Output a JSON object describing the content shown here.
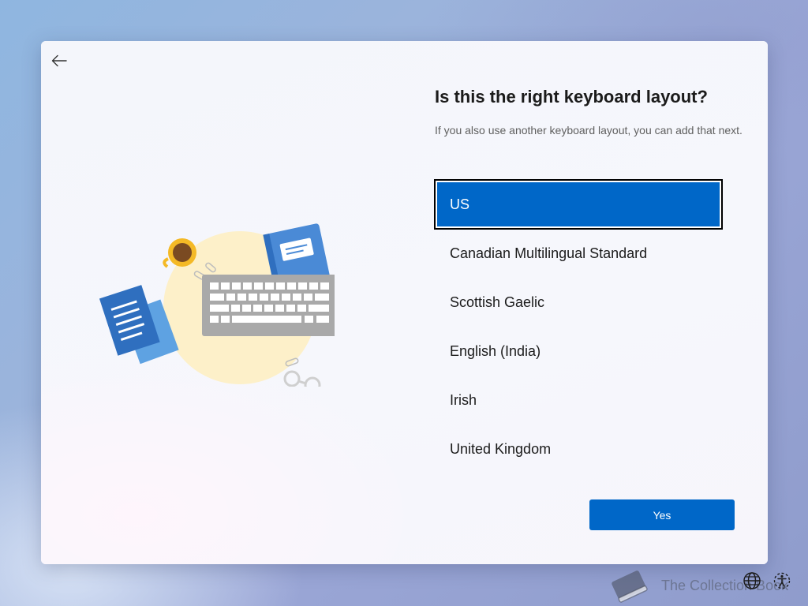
{
  "header": {
    "title": "Is this the right keyboard layout?",
    "subtitle": "If you also use another keyboard layout, you can add that next."
  },
  "layouts": {
    "items": [
      {
        "label": "US",
        "selected": true
      },
      {
        "label": "Canadian Multilingual Standard",
        "selected": false
      },
      {
        "label": "Scottish Gaelic",
        "selected": false
      },
      {
        "label": "English (India)",
        "selected": false
      },
      {
        "label": "Irish",
        "selected": false
      },
      {
        "label": "United Kingdom",
        "selected": false
      }
    ]
  },
  "actions": {
    "yes_label": "Yes"
  },
  "watermark": {
    "text": "The Collection Book"
  },
  "icons": {
    "back": "back-arrow-icon",
    "language": "globe-icon",
    "accessibility": "accessibility-icon"
  },
  "colors": {
    "accent": "#0067c8",
    "window_bg": "#f5f7fc",
    "text": "#1b1b1b",
    "subtext": "#5f5f5f"
  }
}
